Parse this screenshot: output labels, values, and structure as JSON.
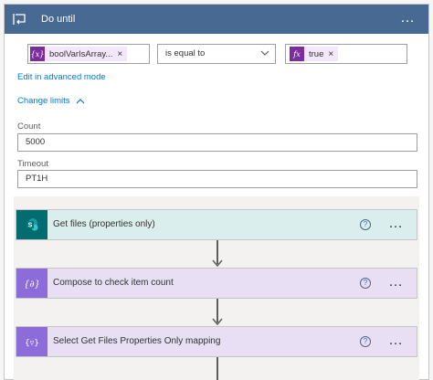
{
  "loop": {
    "title": "Do until",
    "more": "…",
    "condition": {
      "left_token": "boolVarIsArray...",
      "left_token_icon": "{x}",
      "operator": "is equal to",
      "right_token": "true",
      "right_token_icon": "fx",
      "remove_glyph": "×"
    },
    "edit_advanced_label": "Edit in advanced mode",
    "change_limits_label": "Change limits",
    "count_label": "Count",
    "count_value": "5000",
    "timeout_label": "Timeout",
    "timeout_value": "PT1H"
  },
  "actions": [
    {
      "title": "Get files (properties only)",
      "icon": "sharepoint-icon",
      "help": "?",
      "more": "…",
      "color": "#dbeeee",
      "icon_color": "#036c70"
    },
    {
      "title": "Compose to check item count",
      "icon": "compose-icon",
      "help": "?",
      "more": "…",
      "color": "#e8dff5",
      "icon_color": "#8c6cd8"
    },
    {
      "title": "Select Get Files Properties Only mapping",
      "icon": "select-icon",
      "help": "?",
      "more": "…",
      "color": "#e8dff5",
      "icon_color": "#8c6cd8"
    }
  ],
  "colors": {
    "header": "#486991",
    "link": "#0078d4",
    "token": "#7b2d9e"
  }
}
